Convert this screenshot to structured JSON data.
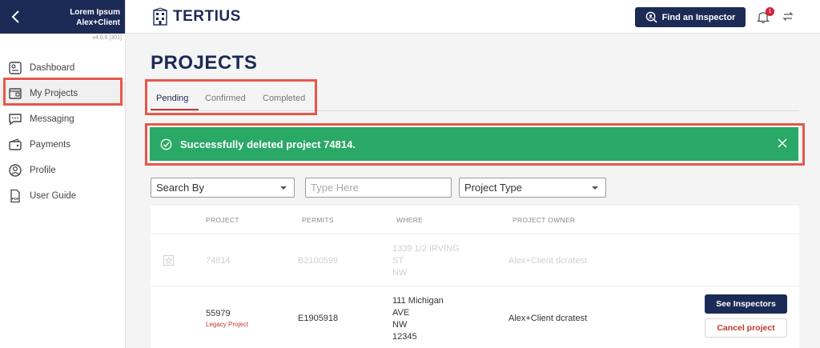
{
  "sidebar": {
    "user_line1": "Lorem Ipsum",
    "user_line2": "Alex+Client",
    "version": "v4.0.6 [301]",
    "items": [
      {
        "label": "Dashboard",
        "icon": "dashboard-icon"
      },
      {
        "label": "My Projects",
        "icon": "projects-icon"
      },
      {
        "label": "Messaging",
        "icon": "messaging-icon"
      },
      {
        "label": "Payments",
        "icon": "payments-icon"
      },
      {
        "label": "Profile",
        "icon": "profile-icon"
      },
      {
        "label": "User Guide",
        "icon": "pdf-icon"
      }
    ]
  },
  "topbar": {
    "logo_text": "TERTIUS",
    "find_button": "Find an Inspector",
    "notification_count": "1"
  },
  "page": {
    "title": "PROJECTS",
    "tabs": [
      "Pending",
      "Confirmed",
      "Completed"
    ],
    "alert_message": "Successfully deleted project 74814."
  },
  "filters": {
    "search_by": "Search By",
    "input_placeholder": "Type Here",
    "project_type": "Project Type"
  },
  "table": {
    "headers": [
      "PROJECT",
      "PERMITS",
      "WHERE",
      "PROJECT OWNER"
    ],
    "rows": [
      {
        "project": "74814",
        "permits": "B2100599",
        "where": [
          "1339 1/2 IRVING",
          "ST",
          "NW"
        ],
        "owner": "Alex+Client dcratest"
      },
      {
        "project": "55979",
        "tag": "Legacy Project",
        "permits": "E1905918",
        "where": [
          "111 Michigan",
          "AVE",
          "NW",
          "12345"
        ],
        "owner": "Alex+Client dcratest",
        "actions": [
          "See Inspectors",
          "Cancel project"
        ]
      }
    ]
  },
  "colors": {
    "brand_navy": "#1c2a56",
    "success_green": "#2aa866",
    "danger_red": "#c0392b",
    "highlight": "#e8574a"
  }
}
